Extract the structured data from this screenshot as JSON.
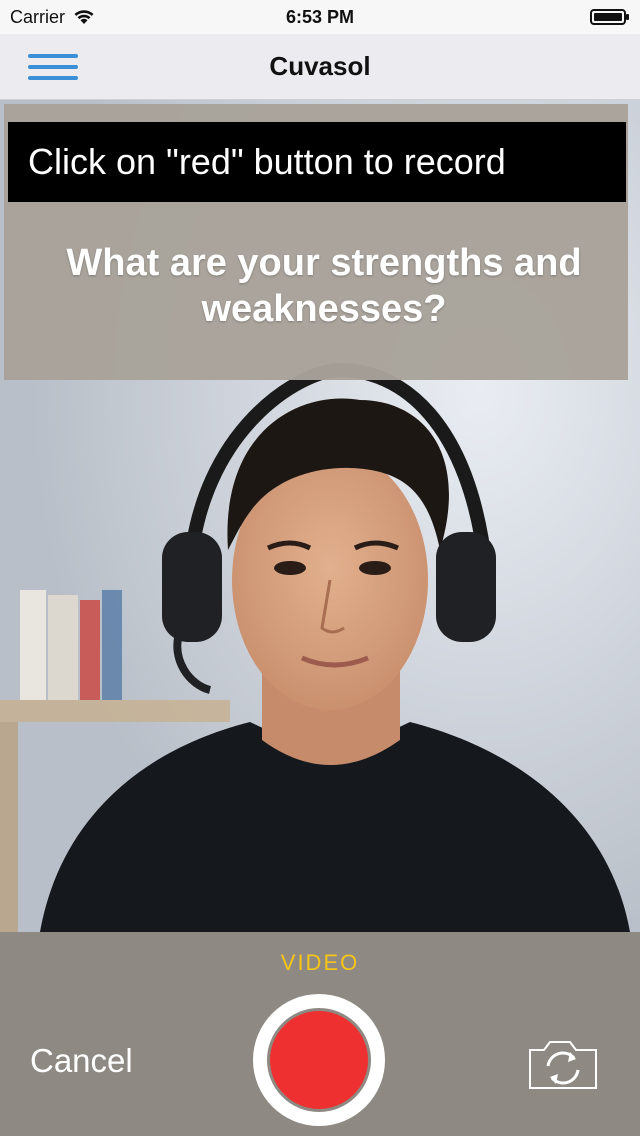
{
  "status_bar": {
    "carrier": "Carrier",
    "time": "6:53 PM",
    "wifi_icon": "wifi-icon",
    "battery_icon": "battery-icon"
  },
  "nav_bar": {
    "title": "Cuvasol",
    "menu_icon": "hamburger-menu-icon",
    "accent_color": "#3a8fd6"
  },
  "question_panel": {
    "instruction": "Click on \"red\" button to record",
    "question": "What are your strengths and weaknesses?"
  },
  "camera_controls": {
    "mode": "VIDEO",
    "cancel_label": "Cancel",
    "record_icon": "record-icon",
    "record_color": "#ee3030",
    "switch_camera_icon": "switch-camera-icon",
    "mode_color": "#f5c518"
  }
}
